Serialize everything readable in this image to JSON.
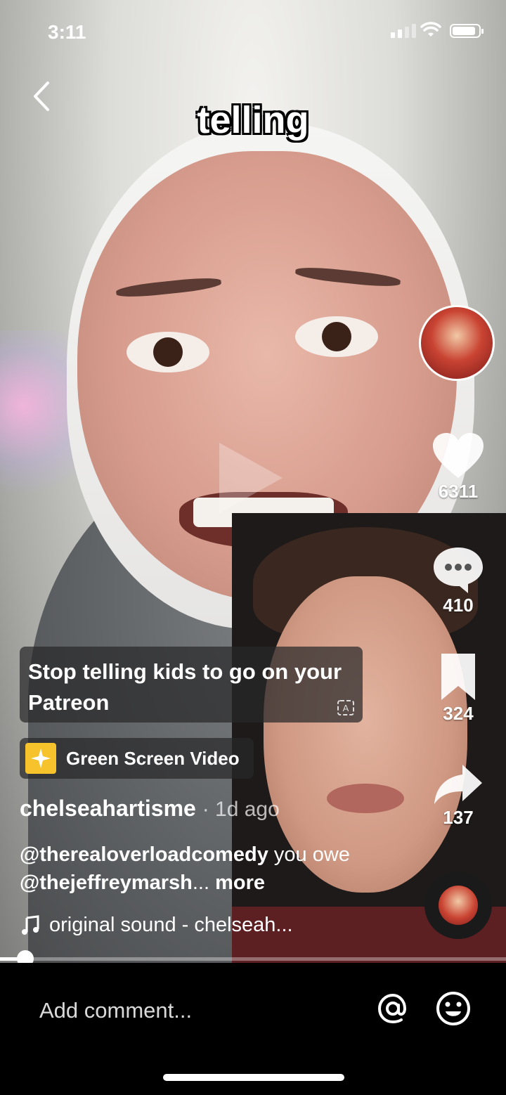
{
  "status_bar": {
    "time": "3:11"
  },
  "video": {
    "caption_word": "telling"
  },
  "overlay_text": "Stop telling kids to go on your Patreon",
  "effect": {
    "label": "Green Screen Video"
  },
  "rail": {
    "likes": "6311",
    "comments": "410",
    "saves": "324",
    "shares": "137"
  },
  "post": {
    "username": "chelseahartisme",
    "age": "· 1d ago",
    "mention1": "@therealoverloadcomedy",
    "text1": " you owe ",
    "mention2": "@thejeffreymarsh",
    "ellipsis": "...",
    "more": " more",
    "sound": "original sound - chelseah..."
  },
  "progress": {
    "fraction": 0.05
  },
  "comment": {
    "placeholder": "Add comment..."
  },
  "icons": {
    "back": "chevron-left-icon",
    "like": "heart-icon",
    "comment": "comment-bubble-icon",
    "save": "bookmark-icon",
    "share": "share-arrow-icon",
    "at": "at-sign-icon",
    "emoji": "smiley-icon",
    "music": "music-note-icon"
  }
}
